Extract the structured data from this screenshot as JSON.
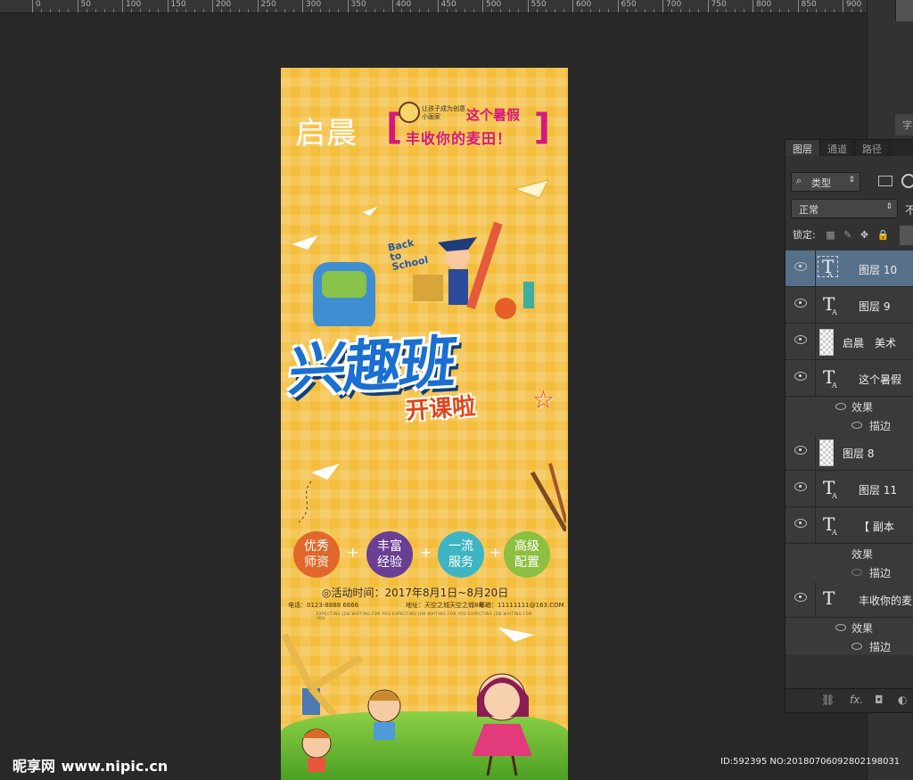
{
  "ruler": {
    "labels": [
      "0",
      "50",
      "100",
      "150",
      "200",
      "250",
      "300",
      "350",
      "400",
      "450",
      "500",
      "550",
      "600",
      "650",
      "700",
      "750",
      "800",
      "850",
      "900"
    ]
  },
  "poster": {
    "brand": "启晨",
    "slogan_small": "让孩子成为创意小画家",
    "slogan_line1": "这个暑假",
    "slogan_line2": "丰收你的麦田！",
    "school_badge": "Back to School",
    "title_main": "兴趣班",
    "title_sub": "开课啦",
    "features": [
      {
        "line1": "优秀",
        "line2": "师资",
        "color": "#e2672a"
      },
      {
        "line1": "丰富",
        "line2": "经验",
        "color": "#6a3f93"
      },
      {
        "line1": "一流",
        "line2": "服务",
        "color": "#3eb5c2"
      },
      {
        "line1": "高级",
        "line2": "配置",
        "color": "#8dc040"
      }
    ],
    "plus": "+",
    "event_time": "◎活动时间：2017年8月1日~8月20日",
    "phone": "电话：0123-8888 6666",
    "address": "地址：天空之城天空之城8号",
    "email": "邮箱：11111111@163.COM",
    "fine_print": "EXPECTING JOB WAITING FOR YOU EXPECTING JOB WAITING FOR YOU EXPECTING JOB WAITING FOR YOU"
  },
  "layers_panel": {
    "tabs": [
      "图层",
      "通道",
      "路径"
    ],
    "filter_label": "类型",
    "blend_mode": "正常",
    "opacity_cut": "不",
    "lock_label": "锁定:",
    "layers": [
      {
        "type": "text",
        "name": "图层 10",
        "selected": true
      },
      {
        "type": "text",
        "name": "图层 9"
      },
      {
        "type": "pixel",
        "name": "启晨　美术"
      },
      {
        "type": "text",
        "name": "这个暑假",
        "effects": "效果",
        "stroke": "描边"
      },
      {
        "type": "pixel",
        "name": "图层 8"
      },
      {
        "type": "text",
        "name": "图层 11"
      },
      {
        "type": "text",
        "name": "【 副本",
        "effects": "效果",
        "stroke": "描边"
      },
      {
        "type": "text-plain",
        "name": "丰收你的麦",
        "effects": "效果",
        "stroke": "描边"
      }
    ],
    "footer_icons": [
      "link-icon",
      "fx-icon",
      "mask-icon",
      "adjust-icon"
    ]
  },
  "watermark": {
    "site_cn": "昵享网",
    "site_url": "www.nipic.cn",
    "id_text": "ID:592395 NO:20180706092802198031"
  },
  "colors": {
    "poster_bg": "#f4be3d",
    "title_blue": "#1a6fd0",
    "pink": "#d6177d",
    "selected_layer": "#56708a"
  }
}
